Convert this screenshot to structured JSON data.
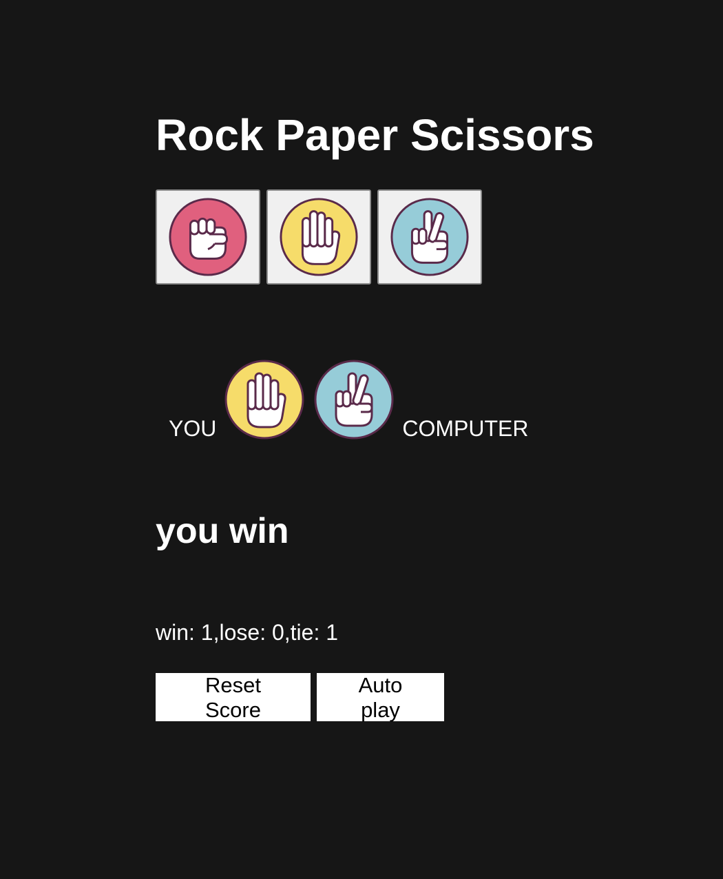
{
  "title": "Rock Paper Scissors",
  "moves": {
    "rock": {
      "icon": "rock-fist-icon",
      "color": "#e0607e"
    },
    "paper": {
      "icon": "paper-hand-icon",
      "color": "#f6dc6a"
    },
    "scissors": {
      "icon": "scissors-hand-icon",
      "color": "#96ccd8"
    }
  },
  "round": {
    "you_label": "YOU",
    "computer_label": "COMPUTER",
    "player_move": "paper",
    "computer_move": "scissors"
  },
  "result": "you win",
  "score_text": "win: 1,lose: 0,tie: 1",
  "buttons": {
    "reset": "Reset Score",
    "auto_play": "Auto play"
  },
  "colors": {
    "background": "#161616",
    "icon_outline": "#5a2a4a"
  }
}
